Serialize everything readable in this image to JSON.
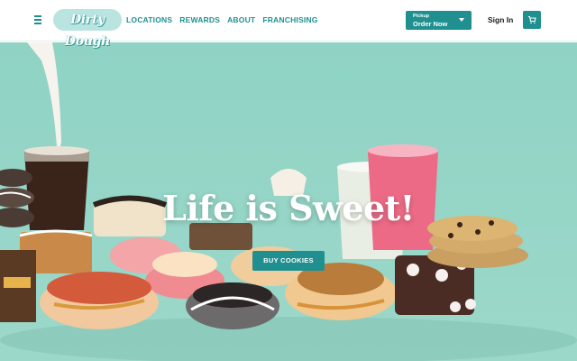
{
  "brand": {
    "logo_text": "Dirty Dough",
    "accent": "#1f8f90",
    "hero_bg": "#8fd3c4"
  },
  "header": {
    "menu_icon": "hamburger-icon",
    "nav": [
      {
        "label": "LOCATIONS"
      },
      {
        "label": "REWARDS"
      },
      {
        "label": "ABOUT"
      },
      {
        "label": "FRANCHISING"
      }
    ],
    "order": {
      "sub_label": "Pickup",
      "label": "Order Now",
      "icon": "chevron-down-icon"
    },
    "signin_label": "Sign In",
    "cart_icon": "cart-icon"
  },
  "hero": {
    "title": "Life is Sweet!",
    "cta_label": "BUY COOKIES"
  }
}
